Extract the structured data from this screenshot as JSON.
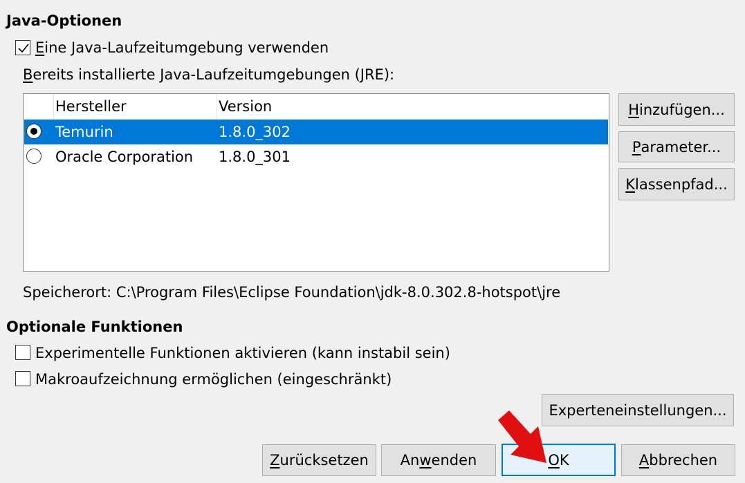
{
  "java": {
    "heading": "Java-Optionen",
    "use_jre": {
      "label_u": "E",
      "label_rest": "ine Java-Laufzeitumgebung verwenden",
      "checked": true
    },
    "installed_u": "B",
    "installed_rest": "ereits installierte Java-Laufzeitumgebungen (JRE):",
    "columns": [
      "Hersteller",
      "Version"
    ],
    "rows": [
      {
        "vendor": "Temurin",
        "version": "1.8.0_302",
        "selected": true
      },
      {
        "vendor": "Oracle Corporation",
        "version": "1.8.0_301",
        "selected": false
      }
    ],
    "buttons": {
      "add_u": "H",
      "add_rest": "inzufügen...",
      "params_u": "P",
      "params_rest": "arameter...",
      "classpath_u": "K",
      "classpath_rest": "lassenpfad..."
    },
    "location": "Speicherort: C:\\Program Files\\Eclipse Foundation\\jdk-8.0.302.8-hotspot\\jre"
  },
  "optional": {
    "heading": "Optionale Funktionen",
    "experimental": {
      "label": "Experimentelle Funktionen aktivieren (kann instabil sein)",
      "checked": false
    },
    "macro": {
      "label": "Makroaufzeichnung ermöglichen (eingeschränkt)",
      "checked": false
    },
    "expert_button": "Experteneinstellungen..."
  },
  "footer": {
    "reset_u": "Z",
    "reset_rest": "urücksetzen",
    "apply_pre": "An",
    "apply_u": "w",
    "apply_rest": "enden",
    "ok_u": "O",
    "ok_rest": "K",
    "cancel_u": "A",
    "cancel_rest": "bbrechen"
  },
  "colors": {
    "selection": "#0078d7",
    "arrow": "#e01010"
  }
}
